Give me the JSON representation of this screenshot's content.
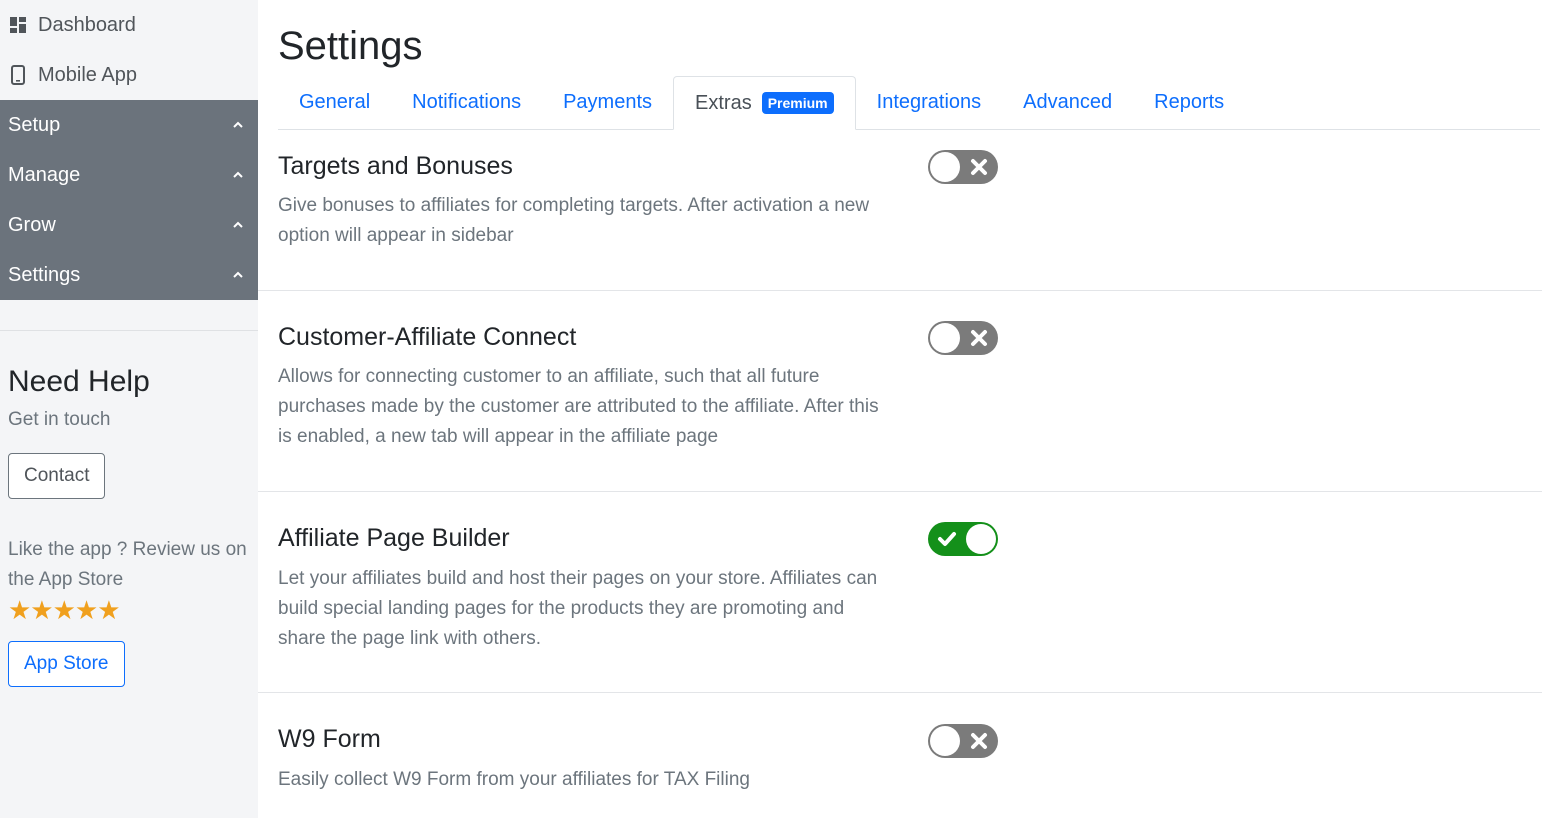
{
  "sidebar": {
    "top_items": [
      {
        "label": "Dashboard",
        "icon": "dashboard-icon"
      },
      {
        "label": "Mobile App",
        "icon": "mobile-icon"
      }
    ],
    "menu": [
      {
        "label": "Setup"
      },
      {
        "label": "Manage"
      },
      {
        "label": "Grow"
      },
      {
        "label": "Settings"
      }
    ],
    "help": {
      "title": "Need Help",
      "subtitle": "Get in touch",
      "contact_label": "Contact",
      "review_text": "Like the app ? Review us on the App Store",
      "rating_stars": 5,
      "stars_text": "★★★★★",
      "appstore_label": "App Store"
    }
  },
  "main": {
    "title": "Settings",
    "tabs": [
      {
        "label": "General"
      },
      {
        "label": "Notifications"
      },
      {
        "label": "Payments"
      },
      {
        "label": "Extras",
        "badge": "Premium",
        "active": true
      },
      {
        "label": "Integrations"
      },
      {
        "label": "Advanced"
      },
      {
        "label": "Reports"
      }
    ],
    "settings": [
      {
        "title": "Targets and Bonuses",
        "description": "Give bonuses to affiliates for completing targets. After activation a new option will appear in sidebar",
        "enabled": false
      },
      {
        "title": "Customer-Affiliate Connect",
        "description": "Allows for connecting customer to an affiliate, such that all future purchases made by the customer are attributed to the affiliate. After this is enabled, a new tab will appear in the affiliate page",
        "enabled": false
      },
      {
        "title": "Affiliate Page Builder",
        "description": "Let your affiliates build and host their pages on your store. Affiliates can build special landing pages for the products they are promoting and share the page link with others.",
        "enabled": true
      },
      {
        "title": "W9 Form",
        "description": "Easily collect W9 Form from your affiliates for TAX Filing",
        "enabled": false
      }
    ]
  },
  "colors": {
    "primary": "#0d6efd",
    "sidebar_menu_bg": "#6b737c",
    "toggle_on": "#14901a",
    "toggle_off": "#7b7b7b",
    "star": "#f0a01e"
  }
}
